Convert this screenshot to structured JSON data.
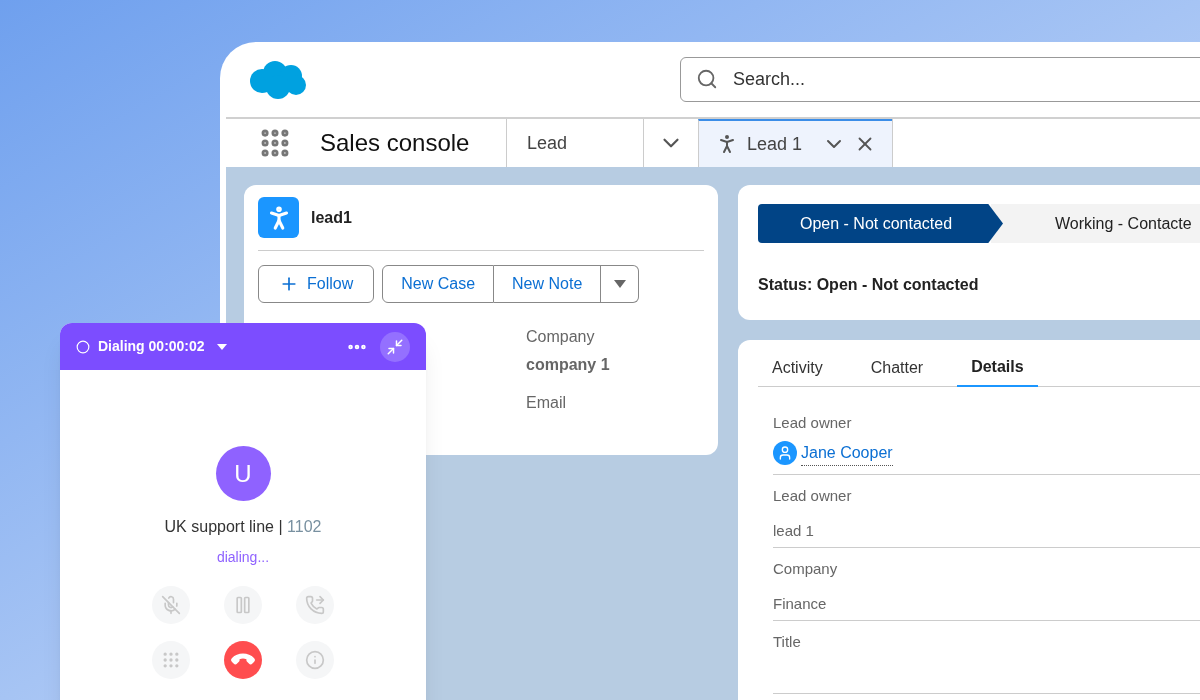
{
  "app": {
    "name": "Sales console"
  },
  "search": {
    "placeholder": "Search..."
  },
  "tabs": [
    {
      "label": "Lead",
      "kind": "nav",
      "selected": false
    },
    {
      "label": "Lead 1",
      "kind": "record",
      "selected": true
    }
  ],
  "record": {
    "title": "lead1",
    "actions": [
      {
        "label": "Follow",
        "kind": "follow"
      },
      {
        "label": "New Case",
        "kind": "group"
      },
      {
        "label": "New Note",
        "kind": "group"
      },
      {
        "kind": "menu"
      }
    ],
    "fields": [
      {
        "label": "Company",
        "value": "company 1"
      },
      {
        "label": "Email"
      }
    ]
  },
  "path": {
    "stages": [
      {
        "label": "Open - Not contacted",
        "selected": true
      },
      {
        "label": "Working - Contacte",
        "selected": false
      }
    ],
    "status": "Status: Open - Not contacted"
  },
  "detail_tabs": [
    {
      "label": "Activity",
      "selected": false
    },
    {
      "label": "Chatter",
      "selected": false
    },
    {
      "label": "Details",
      "selected": true
    }
  ],
  "details": [
    {
      "label": "Lead owner",
      "value": "Jane Cooper",
      "kind": "user"
    },
    {
      "label": "Lead owner",
      "value": "lead 1",
      "kind": "text"
    },
    {
      "label": "Company",
      "value": "Finance",
      "kind": "text"
    },
    {
      "label": "Title",
      "kind": "text"
    }
  ],
  "dialer": {
    "status": "Dialing 00:00:02",
    "avatar": "U",
    "line": "UK support line",
    "separator": "|",
    "number": "1102",
    "state": "dialing...",
    "controls": [
      {
        "kind": "mute",
        "disabled": true
      },
      {
        "kind": "hold",
        "disabled": true
      },
      {
        "kind": "transfer",
        "disabled": true
      },
      {
        "kind": "keypad",
        "disabled": true
      },
      {
        "kind": "hangup",
        "disabled": false
      },
      {
        "kind": "info",
        "disabled": true
      }
    ]
  }
}
